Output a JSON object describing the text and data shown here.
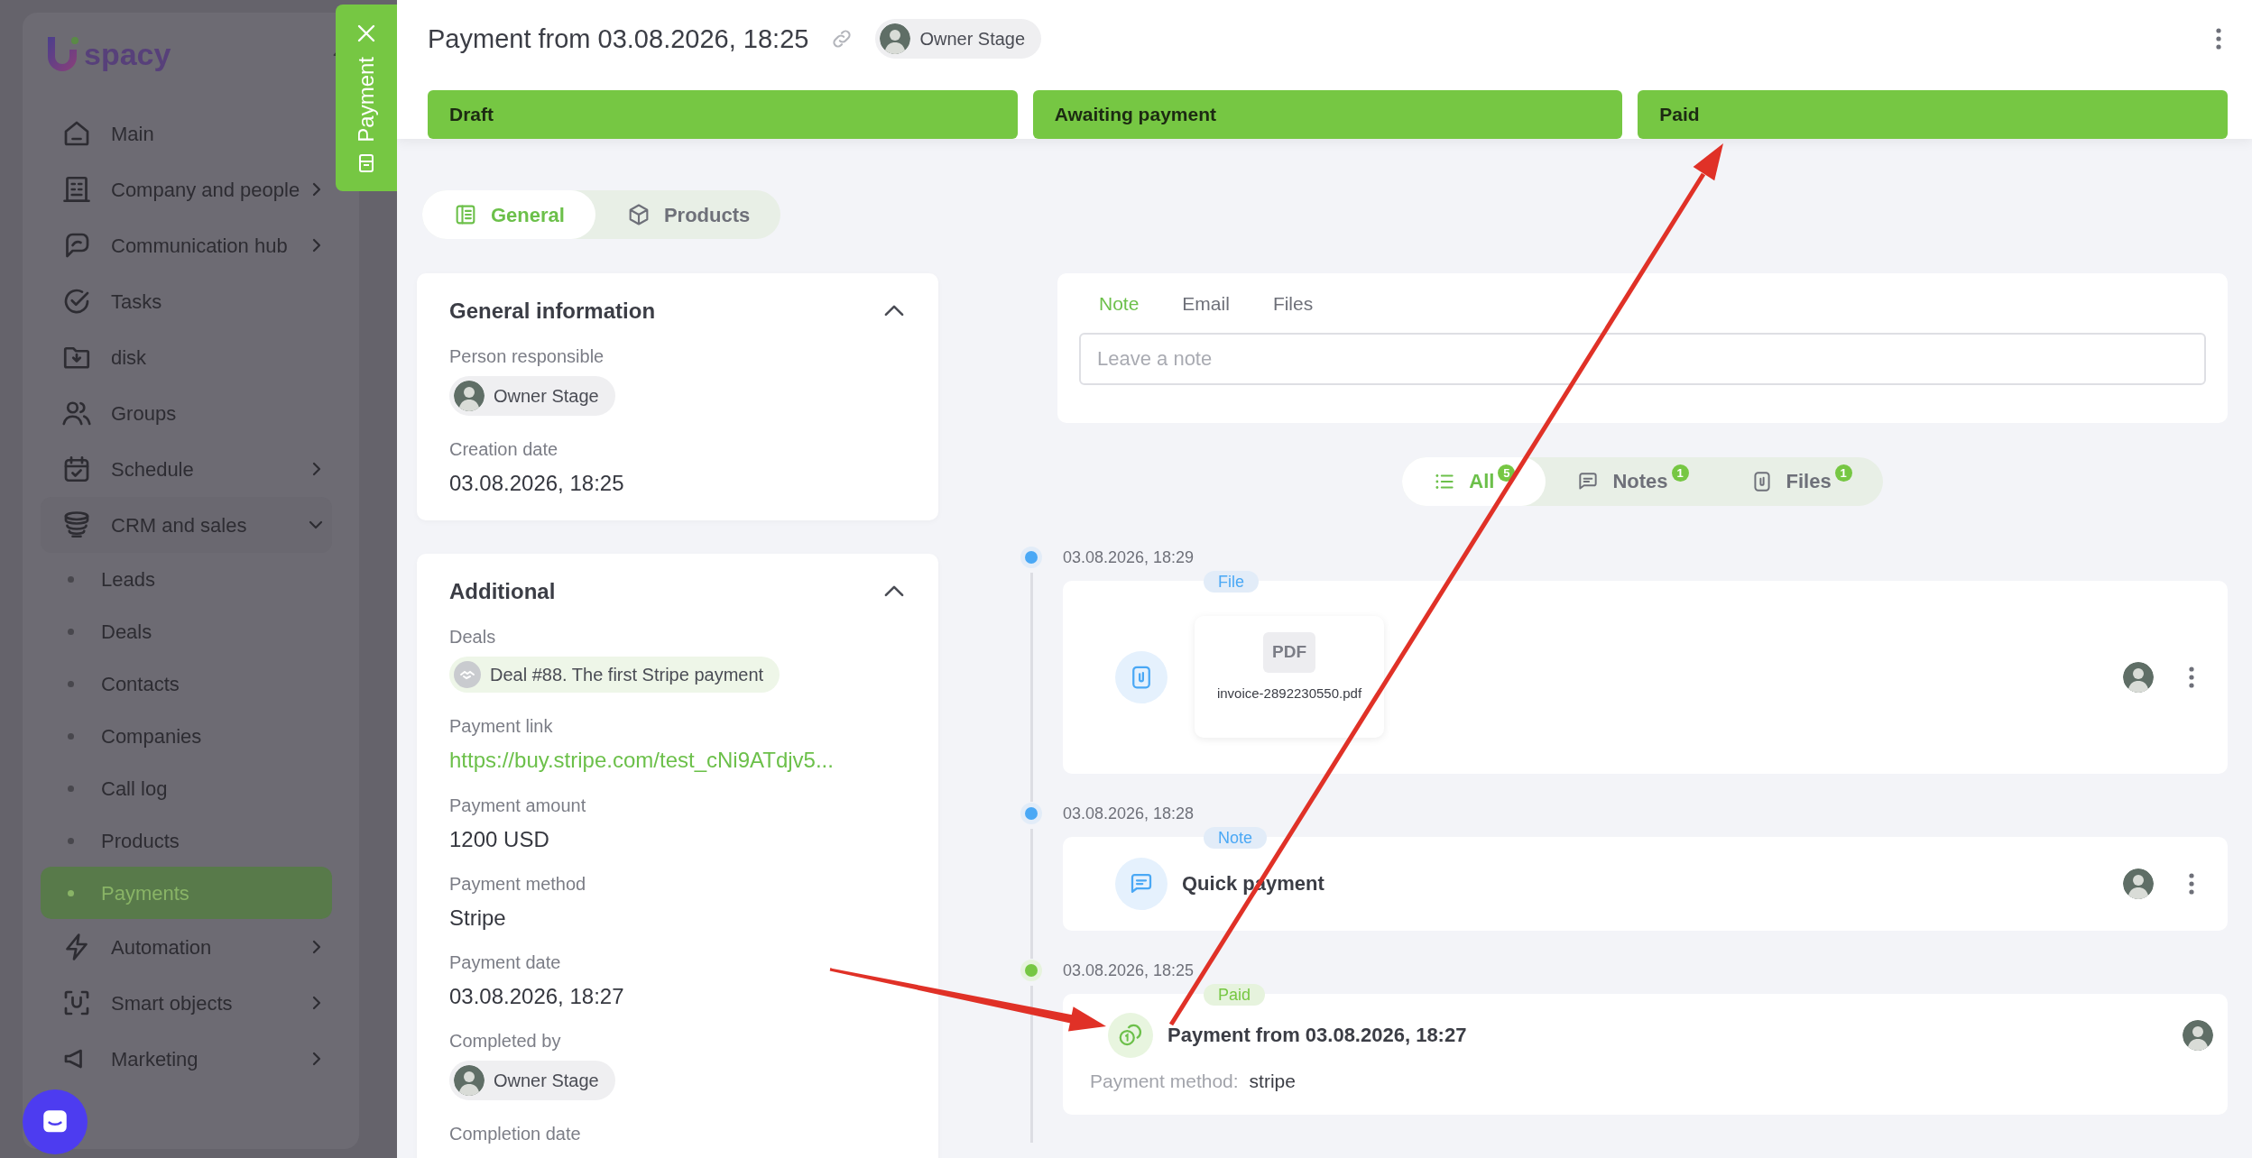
{
  "sidebar": {
    "logo": "spacy",
    "items": [
      {
        "label": "Main",
        "kind": "main",
        "selected": false
      },
      {
        "label": "Company and people",
        "kind": "main",
        "expandable": true,
        "expanded": false,
        "selected": false
      },
      {
        "label": "Communication hub",
        "kind": "main",
        "expandable": true,
        "expanded": false,
        "selected": false
      },
      {
        "label": "Tasks",
        "kind": "main",
        "selected": false
      },
      {
        "label": "disk",
        "kind": "main",
        "selected": false
      },
      {
        "label": "Groups",
        "kind": "main",
        "selected": false
      },
      {
        "label": "Schedule",
        "kind": "main",
        "expandable": true,
        "expanded": false,
        "selected": false
      },
      {
        "label": "CRM and sales",
        "kind": "main",
        "expandable": true,
        "expanded": true,
        "selected": false
      },
      {
        "label": "Leads",
        "kind": "sub",
        "selected": false
      },
      {
        "label": "Deals",
        "kind": "sub",
        "selected": false
      },
      {
        "label": "Contacts",
        "kind": "sub",
        "selected": false
      },
      {
        "label": "Companies",
        "kind": "sub",
        "selected": false
      },
      {
        "label": "Call log",
        "kind": "sub",
        "selected": false
      },
      {
        "label": "Products",
        "kind": "sub",
        "selected": false
      },
      {
        "label": "Payments",
        "kind": "sub",
        "selected": true
      },
      {
        "label": "Automation",
        "kind": "main",
        "expandable": true,
        "expanded": false,
        "selected": false
      },
      {
        "label": "Smart objects",
        "kind": "main",
        "expandable": true,
        "expanded": false,
        "selected": false
      },
      {
        "label": "Marketing",
        "kind": "main",
        "expandable": true,
        "expanded": false,
        "selected": false
      }
    ]
  },
  "side_tab": {
    "label": "Payment"
  },
  "header": {
    "title": "Payment from 03.08.2026, 18:25",
    "owner": "Owner Stage",
    "stages": [
      {
        "label": "Draft",
        "done": true
      },
      {
        "label": "Awaiting payment",
        "done": true
      },
      {
        "label": "Paid",
        "done": true
      }
    ]
  },
  "tabs": [
    {
      "label": "General",
      "selected": true
    },
    {
      "label": "Products",
      "selected": false
    }
  ],
  "panels": [
    {
      "title": "General information",
      "expanded": true,
      "fields": [
        {
          "label": "Person responsible",
          "kind": "person",
          "value": "Owner Stage"
        },
        {
          "label": "Creation date",
          "kind": "text",
          "value": "03.08.2026, 18:25"
        }
      ]
    },
    {
      "title": "Additional",
      "expanded": true,
      "fields": [
        {
          "label": "Deals",
          "kind": "deal",
          "value": "Deal #88. The first Stripe payment"
        },
        {
          "label": "Payment link",
          "kind": "link",
          "value": "https://buy.stripe.com/test_cNi9ATdjv5..."
        },
        {
          "label": "Payment amount",
          "kind": "text",
          "value": "1200 USD"
        },
        {
          "label": "Payment method",
          "kind": "text",
          "value": "Stripe"
        },
        {
          "label": "Payment date",
          "kind": "text",
          "value": "03.08.2026, 18:27"
        },
        {
          "label": "Completed by",
          "kind": "person",
          "value": "Owner Stage"
        },
        {
          "label": "Completion date",
          "kind": "none"
        }
      ]
    }
  ],
  "composer": {
    "tabs": [
      {
        "label": "Note",
        "selected": true
      },
      {
        "label": "Email",
        "selected": false
      },
      {
        "label": "Files",
        "selected": false
      }
    ],
    "placeholder": "Leave a note"
  },
  "filters": [
    {
      "label": "All",
      "count": "5",
      "selected": true
    },
    {
      "label": "Notes",
      "count": "1",
      "selected": false
    },
    {
      "label": "Files",
      "count": "1",
      "selected": false
    }
  ],
  "timeline": [
    {
      "date": "03.08.2026, 18:29",
      "color": "#4aa8f5",
      "tag": "File",
      "kind": "file",
      "file_type": "PDF",
      "file_name": "invoice-2892230550.pdf"
    },
    {
      "date": "03.08.2026, 18:28",
      "color": "#4aa8f5",
      "tag": "Note",
      "kind": "note",
      "text": "Quick payment"
    },
    {
      "date": "03.08.2026, 18:25",
      "color": "#76c743",
      "tag": "Paid",
      "kind": "payment",
      "title": "Payment from 03.08.2026, 18:27",
      "detail_label": "Payment method:",
      "detail_value": "stripe"
    }
  ]
}
